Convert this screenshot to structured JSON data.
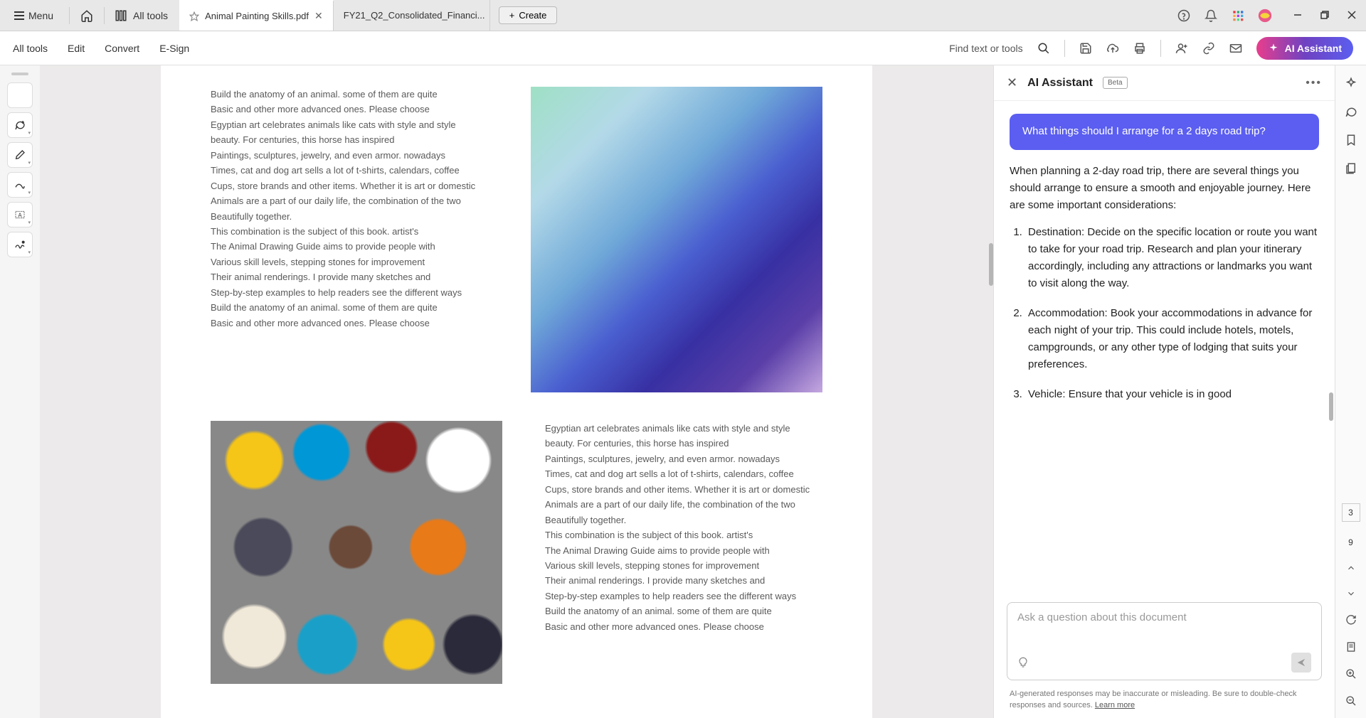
{
  "titlebar": {
    "menu_label": "Menu",
    "alltools_label": "All tools",
    "create_label": "Create"
  },
  "tabs": [
    {
      "label": "Animal Painting Skills.pdf",
      "active": true
    },
    {
      "label": "FY21_Q2_Consolidated_Financi...",
      "active": false
    }
  ],
  "toolbar": {
    "items": [
      "All tools",
      "Edit",
      "Convert",
      "E-Sign"
    ],
    "find_label": "Find text or tools",
    "ai_label": "AI Assistant"
  },
  "document": {
    "block1_lines": [
      "Build the anatomy of an animal. some of them are quite",
      "Basic and other more advanced ones. Please choose",
      "Egyptian art celebrates animals like cats with style and style",
      "beauty. For centuries, this horse has inspired",
      "Paintings, sculptures, jewelry, and even armor. nowadays",
      "Times, cat and dog art sells a lot of t-shirts, calendars, coffee",
      "Cups, store brands and other items. Whether it is art or domestic",
      "Animals are a part of our daily life, the combination of the two",
      "Beautifully together.",
      "This combination is the subject of this book. artist's",
      "The Animal Drawing Guide aims to provide people with",
      "Various skill levels, stepping stones for improvement",
      "Their animal renderings. I provide many sketches and",
      "Step-by-step examples to help readers see the different ways",
      "Build the anatomy of an animal. some of them are quite",
      "Basic and other more advanced ones. Please choose"
    ],
    "block2_lines": [
      "Egyptian art celebrates animals like cats with style and style",
      "beauty. For centuries, this horse has inspired",
      "Paintings, sculptures, jewelry, and even armor. nowadays",
      "Times, cat and dog art sells a lot of t-shirts, calendars, coffee",
      "Cups, store brands and other items. Whether it is art or domestic",
      "Animals are a part of our daily life, the combination of the two",
      "Beautifully together.",
      "This combination is the subject of this book. artist's",
      "The Animal Drawing Guide aims to provide people with",
      "Various skill levels, stepping stones for improvement",
      "Their animal renderings. I provide many sketches and",
      "Step-by-step examples to help readers see the different ways",
      "Build the anatomy of an animal. some of them are quite",
      "Basic and other more advanced ones. Please choose"
    ]
  },
  "ai": {
    "title": "AI Assistant",
    "badge": "Beta",
    "user_msg": "What things should I arrange for a 2 days road trip?",
    "intro": "When planning a 2-day road trip, there are several things you should arrange to ensure a smooth and enjoyable journey. Here are some important considerations:",
    "points": [
      "Destination: Decide on the specific location or route you want to take for your road trip. Research and plan your itinerary accordingly, including any attractions or landmarks you want to visit along the way.",
      "Accommodation: Book your accommodations in advance for each night of your trip. This could include hotels, motels, campgrounds, or any other type of lodging that suits your preferences.",
      "Vehicle: Ensure that your vehicle is in good"
    ],
    "placeholder": "Ask a question about this document",
    "disclaimer": "AI-generated responses may be inaccurate or misleading. Be sure to double-check responses and sources. ",
    "learn_more": "Learn more"
  },
  "page_nav": {
    "current": "3",
    "total": "9"
  }
}
